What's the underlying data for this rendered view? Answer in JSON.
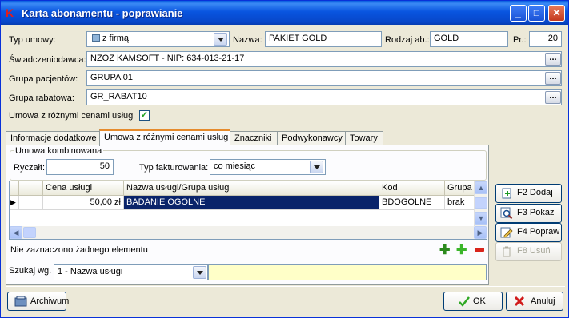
{
  "window": {
    "title": "Karta abonamentu - poprawianie",
    "logo": "K"
  },
  "form": {
    "typ_umowy": {
      "label": "Typ umowy:",
      "value": "z firmą"
    },
    "nazwa": {
      "label": "Nazwa:",
      "value": "PAKIET GOLD"
    },
    "rodzaj_ab": {
      "label": "Rodzaj ab.:",
      "value": "GOLD"
    },
    "pr": {
      "label": "Pr.:",
      "value": "20"
    },
    "swiadczeniodawca": {
      "label": "Świadczeniodawca:",
      "value": "NZOZ KAMSOFT - NIP: 634-013-21-17"
    },
    "grupa_pacjentow": {
      "label": "Grupa pacjentów:",
      "value": "GRUPA 01"
    },
    "grupa_rabatowa": {
      "label": "Grupa rabatowa:",
      "value": "GR_RABAT10"
    },
    "umowa_checkbox": {
      "label": "Umowa z różnymi cenami usług",
      "checked": true
    },
    "dots": "..."
  },
  "tabs": [
    "Informacje dodatkowe",
    "Umowa z różnymi cenami usług",
    "Znaczniki",
    "Podwykonawcy",
    "Towary"
  ],
  "active_tab": 1,
  "umowa_kombinowana": {
    "title": "Umowa kombinowana",
    "ryczalt_label": "Ryczałt:",
    "ryczalt_value": "50",
    "typ_fakturowania_label": "Typ fakturowania:",
    "typ_fakturowania_value": "co miesiąc"
  },
  "table": {
    "columns": [
      "Cena usługi",
      "Nazwa usługi/Grupa usług",
      "Kod",
      "Grupa"
    ],
    "rows": [
      {
        "cena": "50,00 zł",
        "nazwa": "BADANIE OGOLNE",
        "kod": "BDOGOLNE",
        "grupa": "brak"
      }
    ],
    "row_indicator": "▶"
  },
  "status_text": "Nie zaznaczono żadnego elementu",
  "search": {
    "label": "Szukaj wg.",
    "option": "1 - Nazwa usługi",
    "value": ""
  },
  "side_buttons": [
    {
      "label": "F2 Dodaj",
      "icon": "add-document-icon",
      "enabled": true
    },
    {
      "label": "F3 Pokaż",
      "icon": "magnifier-icon",
      "enabled": true
    },
    {
      "label": "F4 Popraw",
      "icon": "edit-pencil-icon",
      "enabled": true
    },
    {
      "label": "F8 Usuń",
      "icon": "trash-icon",
      "enabled": false
    }
  ],
  "bottom": {
    "archiwum": "Archiwum",
    "ok": "OK",
    "anuluj": "Anuluj"
  },
  "colors": {
    "title_bar": "#0a5fe0",
    "selection": "#0a246a",
    "search_field": "#ffffc8",
    "active_tab_accent": "#e68b2c"
  }
}
